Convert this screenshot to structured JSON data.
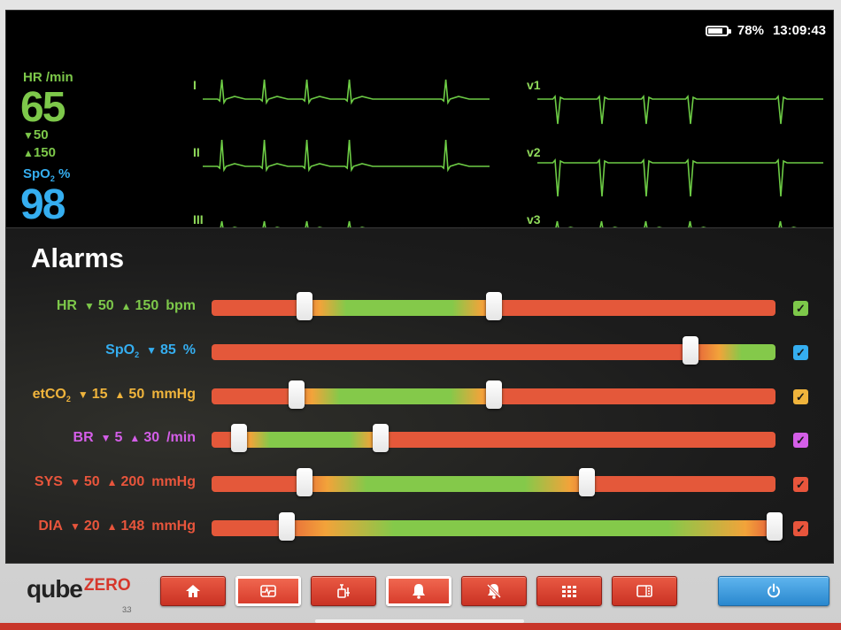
{
  "status": {
    "battery": "78%",
    "time": "13:09:43",
    "battery_level": 0.78
  },
  "vitals": {
    "hr": {
      "label": "HR /min",
      "value": "65",
      "low": "50",
      "high": "150"
    },
    "spo2": {
      "label_main": "SpO",
      "label_sub": "2",
      "label_unit": "%",
      "value": "98"
    }
  },
  "ecg": {
    "leads": [
      "I",
      "II",
      "III",
      "v1",
      "v2",
      "v3"
    ]
  },
  "alarms": {
    "title": "Alarms",
    "rows": [
      {
        "name": "HR",
        "sub": "",
        "low": "50",
        "high": "150",
        "unit": "bpm",
        "color": "#7dc84a",
        "thumbs": [
          0.165,
          0.5
        ],
        "checked": true
      },
      {
        "name": "SpO",
        "sub": "2",
        "low": "85",
        "high": "",
        "unit": "%",
        "color": "#35aef0",
        "thumbs": [
          0.85
        ],
        "checked": true
      },
      {
        "name": "etCO",
        "sub": "2",
        "low": "15",
        "high": "50",
        "unit": "mmHg",
        "color": "#f0b43c",
        "thumbs": [
          0.15,
          0.5
        ],
        "checked": true
      },
      {
        "name": "BR",
        "sub": "",
        "low": "5",
        "high": "30",
        "unit": "/min",
        "color": "#d45ee8",
        "thumbs": [
          0.048,
          0.3
        ],
        "checked": true
      },
      {
        "name": "SYS",
        "sub": "",
        "low": "50",
        "high": "200",
        "unit": "mmHg",
        "color": "#e8553c",
        "thumbs": [
          0.165,
          0.665
        ],
        "checked": true
      },
      {
        "name": "DIA",
        "sub": "",
        "low": "20",
        "high": "148",
        "unit": "mmHg",
        "color": "#e8553c",
        "thumbs": [
          0.133,
          0.999
        ],
        "checked": true
      }
    ]
  },
  "brand": {
    "name": "qube",
    "accent": "ZERO",
    "version": "3.3"
  },
  "toolbar": {
    "buttons": [
      {
        "icon": "home-icon",
        "active": false
      },
      {
        "icon": "waveform-icon",
        "active": true
      },
      {
        "icon": "syringe-icon",
        "active": false
      },
      {
        "icon": "bell-icon",
        "active": true
      },
      {
        "icon": "bell-muted-icon",
        "active": false
      },
      {
        "icon": "grid-icon",
        "active": false
      },
      {
        "icon": "sidebar-panel-icon",
        "active": false
      }
    ],
    "power_icon": "power-icon"
  }
}
